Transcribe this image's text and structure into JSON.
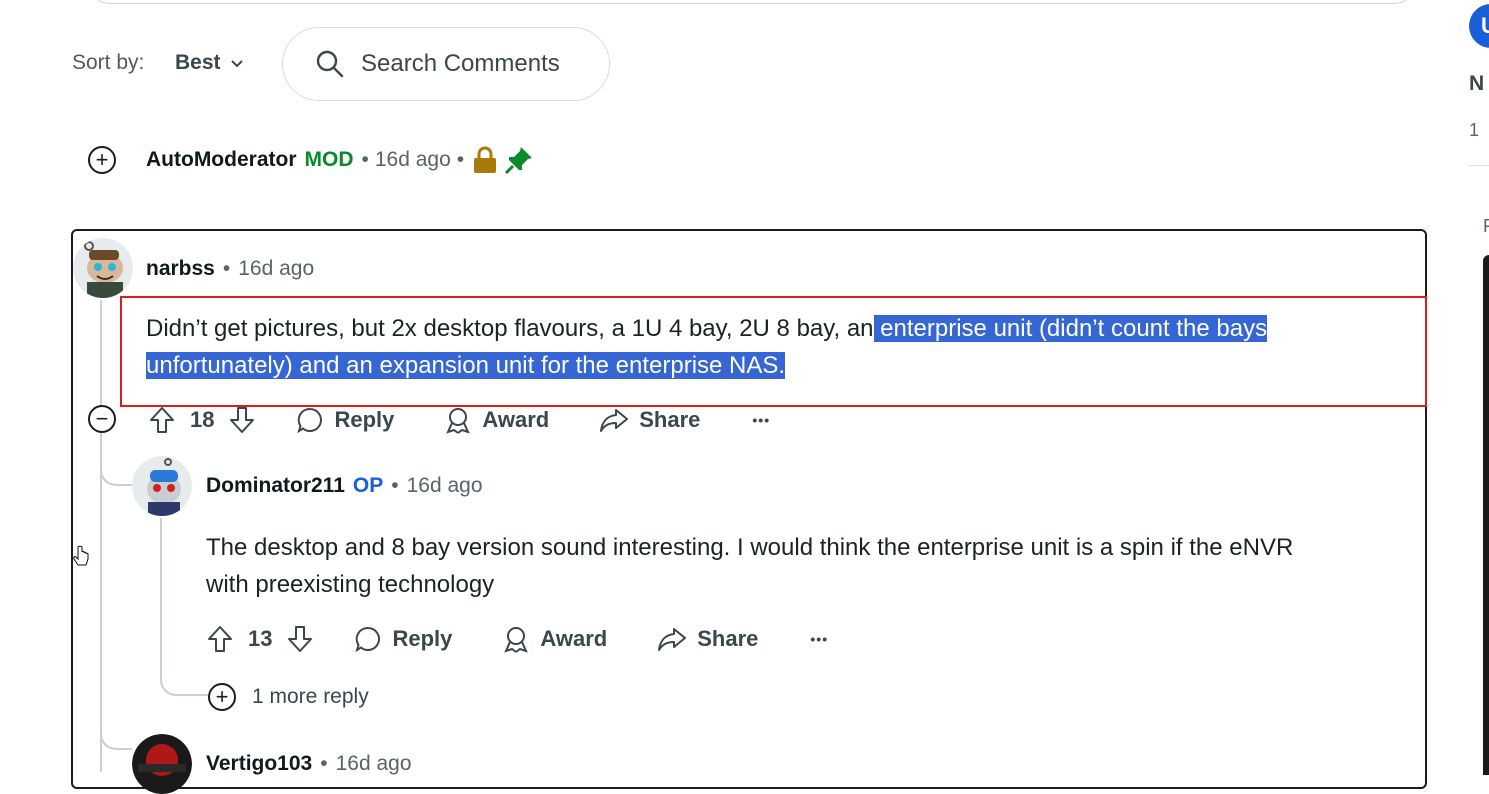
{
  "sort": {
    "label": "Sort by:",
    "value": "Best"
  },
  "search": {
    "placeholder": "Search Comments"
  },
  "automod": {
    "username": "AutoModerator",
    "badge": "MOD",
    "sep1": "•",
    "time": "16d ago",
    "sep2": "•",
    "expand": "+"
  },
  "comment": {
    "username": "narbss",
    "sep": "•",
    "time": "16d ago",
    "text_before": "Didn’t get pictures, but 2x desktop flavours, a 1U 4 bay, 2U 8 bay, an",
    "text_selected_1": " enterprise unit (didn’t count the bays",
    "text_selected_2": "unfortunately) and an expansion unit for the enterprise NAS.",
    "score": "18",
    "collapse": "−",
    "actions": {
      "reply": "Reply",
      "award": "Award",
      "share": "Share",
      "more": "•••"
    }
  },
  "reply1": {
    "username": "Dominator211",
    "badge": "OP",
    "sep": "•",
    "time": "16d ago",
    "text_line1": "The desktop and 8 bay version sound interesting. I would think the enterprise unit is a spin if the eNVR",
    "text_line2": "with preexisting technology",
    "score": "13",
    "actions": {
      "reply": "Reply",
      "award": "Award",
      "share": "Share",
      "more": "•••"
    },
    "more_replies": "1 more reply",
    "expand": "+"
  },
  "reply2": {
    "username": "Vertigo103",
    "sep": "•",
    "time": "16d ago"
  },
  "right_panel": {
    "badge_letter": "U",
    "n_letter": "N",
    "count_fragment": "1",
    "r_letter": "F"
  },
  "colors": {
    "mod": "#0a8a2a",
    "op": "#1a5fd6",
    "selection": "#3566d4",
    "highlight_border": "#e01b1b"
  }
}
